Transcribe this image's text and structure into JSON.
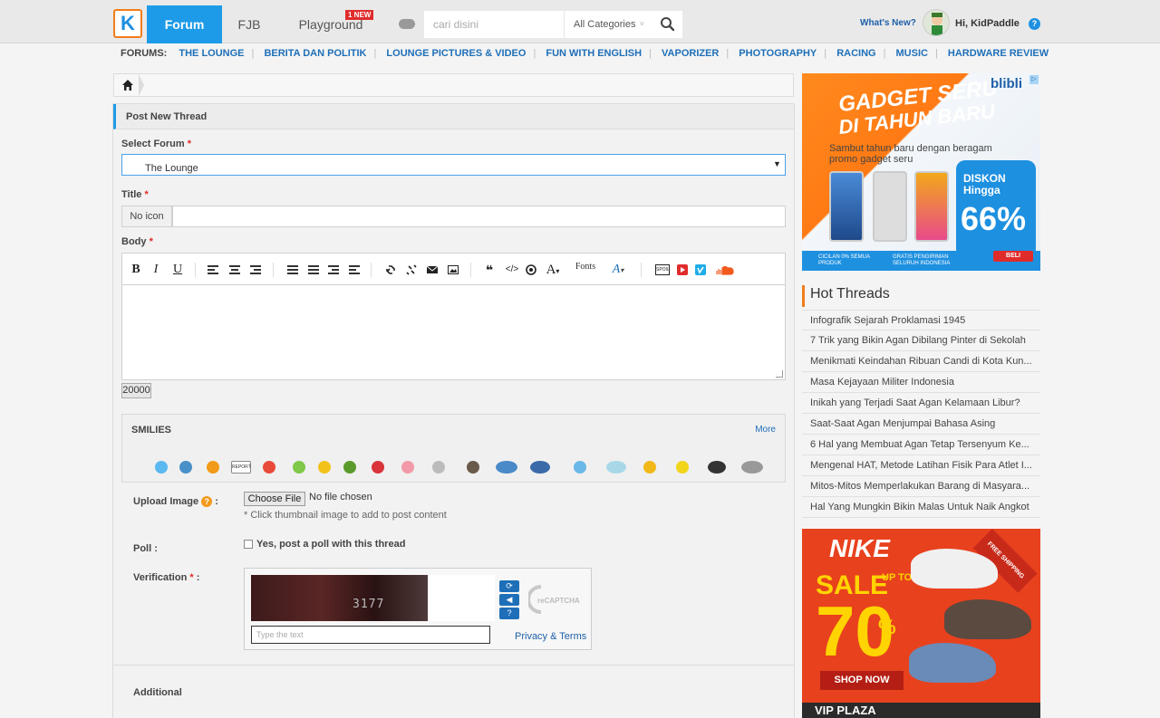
{
  "topbar": {
    "logo": "K",
    "nav": {
      "forum": "Forum",
      "fjb": "FJB",
      "playground": "Playground",
      "new_badge": "1 NEW"
    },
    "search": {
      "placeholder": "cari disini",
      "category": "All Categories"
    },
    "whats_new": "What's New?",
    "greeting": "Hi, KidPaddle",
    "help": "?"
  },
  "forums_bar": {
    "label": "FORUMS:",
    "links": [
      "THE LOUNGE",
      "BERITA DAN POLITIK",
      "LOUNGE PICTURES & VIDEO",
      "FUN WITH ENGLISH",
      "VAPORIZER",
      "PHOTOGRAPHY",
      "RACING",
      "MUSIC",
      "HARDWARE REVIEW"
    ]
  },
  "form": {
    "title": "Post New Thread",
    "select_forum_label": "Select Forum",
    "selected_forum": "The Lounge",
    "title_label": "Title",
    "no_icon": "No icon",
    "body_label": "Body",
    "fonts_label": "Fonts",
    "char_count": "20000",
    "smilies_title": "SMILIES",
    "smilies_more": "More",
    "upload_label": "Upload Image",
    "choose_file": "Choose File",
    "no_file": "No file chosen",
    "upload_hint": "* Click thumbnail image to add to post content",
    "poll_label": "Poll :",
    "poll_checkbox": "Yes, post a poll with this thread",
    "verification_label": "Verification",
    "captcha_placeholder": "Type the text",
    "captcha_text": "3177",
    "privacy_terms": "Privacy & Terms",
    "additional": "Additional",
    "required_mark": "*"
  },
  "toolbar": {
    "bold": "B",
    "italic": "I",
    "underline": "U",
    "quote": "❝",
    "code": "</>",
    "font_size": "A"
  },
  "hot_threads": {
    "title": "Hot Threads",
    "items": [
      "Infografik Sejarah Proklamasi 1945",
      "7 Trik yang Bikin Agan Dibilang Pinter di Sekolah",
      "Menikmati Keindahan Ribuan Candi di Kota Kun...",
      "Masa Kejayaan Militer Indonesia",
      "Inikah yang Terjadi Saat Agan Kelamaan Libur?",
      "Saat-Saat Agan Menjumpai Bahasa Asing",
      "6 Hal yang Membuat Agan Tetap Tersenyum Ke...",
      "Mengenal HAT, Metode Latihan Fisik Para Atlet I...",
      "Mitos-Mitos Memperlakukan Barang di Masyara...",
      "Hal Yang Mungkin Bikin Malas Untuk Naik Angkot"
    ]
  },
  "ads": {
    "blibli": {
      "line1": "GADGET SERU",
      "line2": "DI TAHUN BARU",
      "brand": "blibli",
      "sub": "Sambut tahun baru dengan beragam promo gadget seru",
      "discount_label": "DISKON Hingga",
      "discount_value": "66%",
      "strip1": "CICILAN 0% SEMUA PRODUK",
      "strip2": "GRATIS PENGIRIMAN SELURUH INDONESIA",
      "beli": "BELI"
    },
    "nike": {
      "brand": "NIKE",
      "sale": "SALE",
      "upto": "UP TO",
      "percent": "70",
      "pct_sign": "%",
      "shop": "SHOP NOW",
      "vip": "VIP PLAZA",
      "ribbon": "FREE SHIPPING"
    }
  },
  "colors": {
    "accent": "#1e9be8",
    "required": "#e02b2b",
    "link": "#1e6fb8",
    "logo_border": "#f27d1a"
  }
}
